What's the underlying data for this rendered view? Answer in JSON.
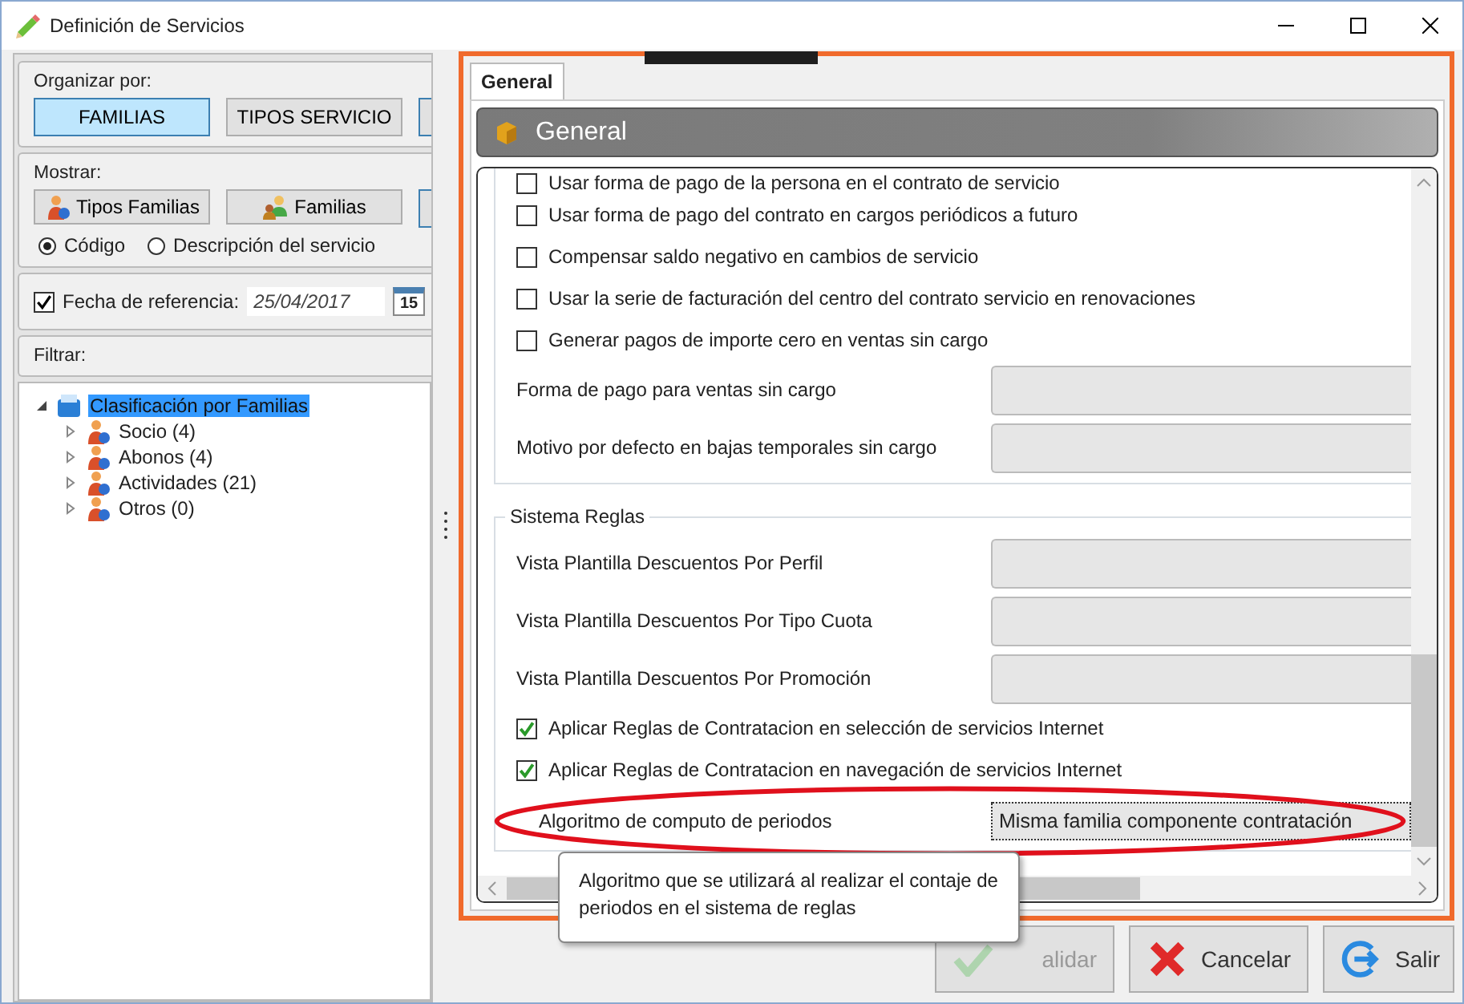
{
  "window": {
    "title": "Definición de Servicios"
  },
  "left": {
    "organize": {
      "label": "Organizar por:",
      "buttons": [
        {
          "label": "FAMILIAS",
          "selected": true
        },
        {
          "label": "TIPOS SERVICIO",
          "selected": false
        }
      ]
    },
    "show": {
      "label": "Mostrar:",
      "buttons": [
        {
          "label": "Tipos Familias",
          "kind": "person"
        },
        {
          "label": "Familias",
          "kind": "group"
        }
      ],
      "radios": [
        {
          "label": "Código",
          "selected": true
        },
        {
          "label": "Descripción del servicio",
          "selected": false
        }
      ]
    },
    "reference_date": {
      "label": "Fecha de referencia:",
      "checked": true,
      "value": "25/04/2017",
      "calendar_day": "15"
    },
    "filter": {
      "label": "Filtrar:"
    },
    "tree": [
      {
        "label": "Clasificación por Familias",
        "expanded": true,
        "selected": true,
        "children": [
          {
            "label": "Socio (4)",
            "expanded": false,
            "selected": false
          },
          {
            "label": "Abonos (4)",
            "expanded": false,
            "selected": false
          },
          {
            "label": "Actividades (21)",
            "expanded": false,
            "selected": false
          },
          {
            "label": "Otros (0)",
            "expanded": false,
            "selected": false
          }
        ]
      }
    ]
  },
  "tabs": [
    {
      "label": "General",
      "selected": true
    }
  ],
  "header": {
    "title": "General"
  },
  "section1": {
    "checkboxes": [
      {
        "label": "Usar forma de pago de la persona en el contrato de servicio",
        "checked": false
      },
      {
        "label": "Usar forma de pago del contrato en cargos periódicos a futuro",
        "checked": false
      },
      {
        "label": "Compensar saldo negativo en cambios de servicio",
        "checked": false
      },
      {
        "label": "Usar la serie de facturación del centro del contrato servicio en renovaciones",
        "checked": false
      },
      {
        "label": "Generar pagos de importe cero en ventas sin cargo",
        "checked": false
      }
    ],
    "fields": [
      {
        "label": "Forma de pago para ventas sin cargo",
        "disabled": true
      },
      {
        "label": "Motivo por defecto en bajas temporales sin cargo",
        "disabled": true
      }
    ]
  },
  "rules": {
    "title": "Sistema Reglas",
    "fields": [
      {
        "label": "Vista Plantilla Descuentos Por Perfil",
        "disabled": true
      },
      {
        "label": "Vista Plantilla Descuentos Por Tipo Cuota",
        "disabled": true
      },
      {
        "label": "Vista Plantilla Descuentos Por Promoción",
        "disabled": true
      }
    ],
    "checkboxes": [
      {
        "label": "Aplicar Reglas de Contratacion en selección de servicios Internet",
        "checked": true
      },
      {
        "label": "Aplicar Reglas de Contratacion en navegación de servicios Internet",
        "checked": true
      }
    ],
    "dropdown": {
      "label": "Algoritmo de computo de periodos",
      "value": "Misma familia componente contratación",
      "highlighted": true
    }
  },
  "tooltip": "Algoritmo que se utilizará al realizar el contaje de periodos en el sistema de reglas",
  "buttons": [
    {
      "label": "alidar",
      "kind": "validate",
      "disabled": true
    },
    {
      "label": "Cancelar",
      "kind": "cancel",
      "disabled": false
    },
    {
      "label": "Salir",
      "kind": "exit",
      "disabled": false
    }
  ]
}
